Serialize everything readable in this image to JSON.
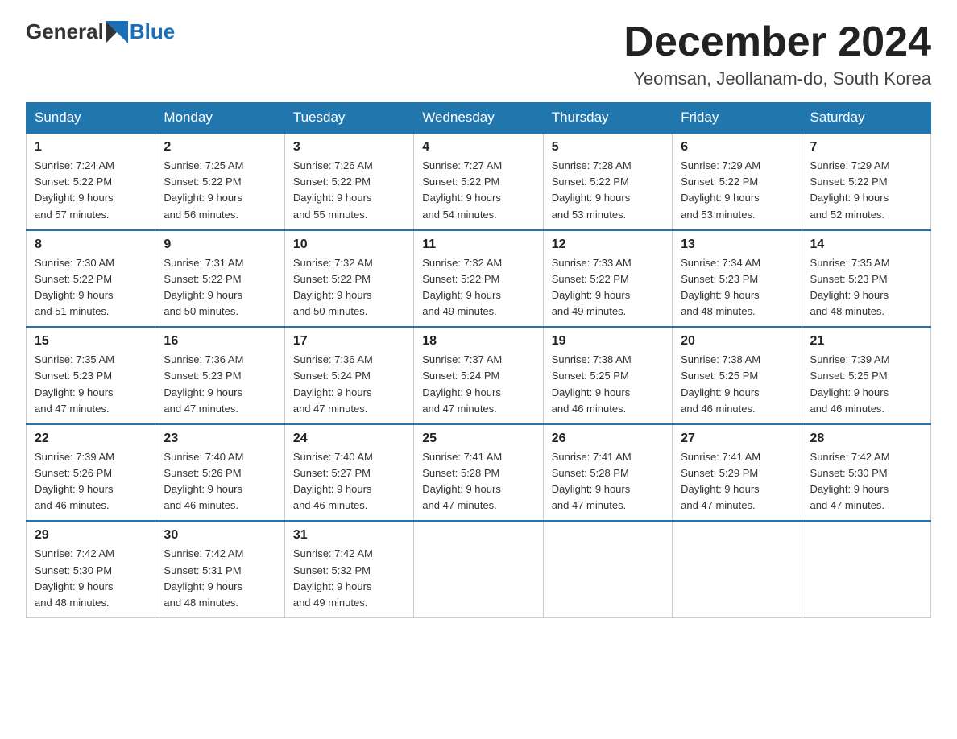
{
  "header": {
    "logo_general": "General",
    "logo_blue": "Blue",
    "month_title": "December 2024",
    "location": "Yeomsan, Jeollanam-do, South Korea"
  },
  "days_of_week": [
    "Sunday",
    "Monday",
    "Tuesday",
    "Wednesday",
    "Thursday",
    "Friday",
    "Saturday"
  ],
  "weeks": [
    [
      {
        "day": "1",
        "sunrise": "7:24 AM",
        "sunset": "5:22 PM",
        "daylight": "9 hours and 57 minutes."
      },
      {
        "day": "2",
        "sunrise": "7:25 AM",
        "sunset": "5:22 PM",
        "daylight": "9 hours and 56 minutes."
      },
      {
        "day": "3",
        "sunrise": "7:26 AM",
        "sunset": "5:22 PM",
        "daylight": "9 hours and 55 minutes."
      },
      {
        "day": "4",
        "sunrise": "7:27 AM",
        "sunset": "5:22 PM",
        "daylight": "9 hours and 54 minutes."
      },
      {
        "day": "5",
        "sunrise": "7:28 AM",
        "sunset": "5:22 PM",
        "daylight": "9 hours and 53 minutes."
      },
      {
        "day": "6",
        "sunrise": "7:29 AM",
        "sunset": "5:22 PM",
        "daylight": "9 hours and 53 minutes."
      },
      {
        "day": "7",
        "sunrise": "7:29 AM",
        "sunset": "5:22 PM",
        "daylight": "9 hours and 52 minutes."
      }
    ],
    [
      {
        "day": "8",
        "sunrise": "7:30 AM",
        "sunset": "5:22 PM",
        "daylight": "9 hours and 51 minutes."
      },
      {
        "day": "9",
        "sunrise": "7:31 AM",
        "sunset": "5:22 PM",
        "daylight": "9 hours and 50 minutes."
      },
      {
        "day": "10",
        "sunrise": "7:32 AM",
        "sunset": "5:22 PM",
        "daylight": "9 hours and 50 minutes."
      },
      {
        "day": "11",
        "sunrise": "7:32 AM",
        "sunset": "5:22 PM",
        "daylight": "9 hours and 49 minutes."
      },
      {
        "day": "12",
        "sunrise": "7:33 AM",
        "sunset": "5:22 PM",
        "daylight": "9 hours and 49 minutes."
      },
      {
        "day": "13",
        "sunrise": "7:34 AM",
        "sunset": "5:23 PM",
        "daylight": "9 hours and 48 minutes."
      },
      {
        "day": "14",
        "sunrise": "7:35 AM",
        "sunset": "5:23 PM",
        "daylight": "9 hours and 48 minutes."
      }
    ],
    [
      {
        "day": "15",
        "sunrise": "7:35 AM",
        "sunset": "5:23 PM",
        "daylight": "9 hours and 47 minutes."
      },
      {
        "day": "16",
        "sunrise": "7:36 AM",
        "sunset": "5:23 PM",
        "daylight": "9 hours and 47 minutes."
      },
      {
        "day": "17",
        "sunrise": "7:36 AM",
        "sunset": "5:24 PM",
        "daylight": "9 hours and 47 minutes."
      },
      {
        "day": "18",
        "sunrise": "7:37 AM",
        "sunset": "5:24 PM",
        "daylight": "9 hours and 47 minutes."
      },
      {
        "day": "19",
        "sunrise": "7:38 AM",
        "sunset": "5:25 PM",
        "daylight": "9 hours and 46 minutes."
      },
      {
        "day": "20",
        "sunrise": "7:38 AM",
        "sunset": "5:25 PM",
        "daylight": "9 hours and 46 minutes."
      },
      {
        "day": "21",
        "sunrise": "7:39 AM",
        "sunset": "5:25 PM",
        "daylight": "9 hours and 46 minutes."
      }
    ],
    [
      {
        "day": "22",
        "sunrise": "7:39 AM",
        "sunset": "5:26 PM",
        "daylight": "9 hours and 46 minutes."
      },
      {
        "day": "23",
        "sunrise": "7:40 AM",
        "sunset": "5:26 PM",
        "daylight": "9 hours and 46 minutes."
      },
      {
        "day": "24",
        "sunrise": "7:40 AM",
        "sunset": "5:27 PM",
        "daylight": "9 hours and 46 minutes."
      },
      {
        "day": "25",
        "sunrise": "7:41 AM",
        "sunset": "5:28 PM",
        "daylight": "9 hours and 47 minutes."
      },
      {
        "day": "26",
        "sunrise": "7:41 AM",
        "sunset": "5:28 PM",
        "daylight": "9 hours and 47 minutes."
      },
      {
        "day": "27",
        "sunrise": "7:41 AM",
        "sunset": "5:29 PM",
        "daylight": "9 hours and 47 minutes."
      },
      {
        "day": "28",
        "sunrise": "7:42 AM",
        "sunset": "5:30 PM",
        "daylight": "9 hours and 47 minutes."
      }
    ],
    [
      {
        "day": "29",
        "sunrise": "7:42 AM",
        "sunset": "5:30 PM",
        "daylight": "9 hours and 48 minutes."
      },
      {
        "day": "30",
        "sunrise": "7:42 AM",
        "sunset": "5:31 PM",
        "daylight": "9 hours and 48 minutes."
      },
      {
        "day": "31",
        "sunrise": "7:42 AM",
        "sunset": "5:32 PM",
        "daylight": "9 hours and 49 minutes."
      },
      null,
      null,
      null,
      null
    ]
  ]
}
